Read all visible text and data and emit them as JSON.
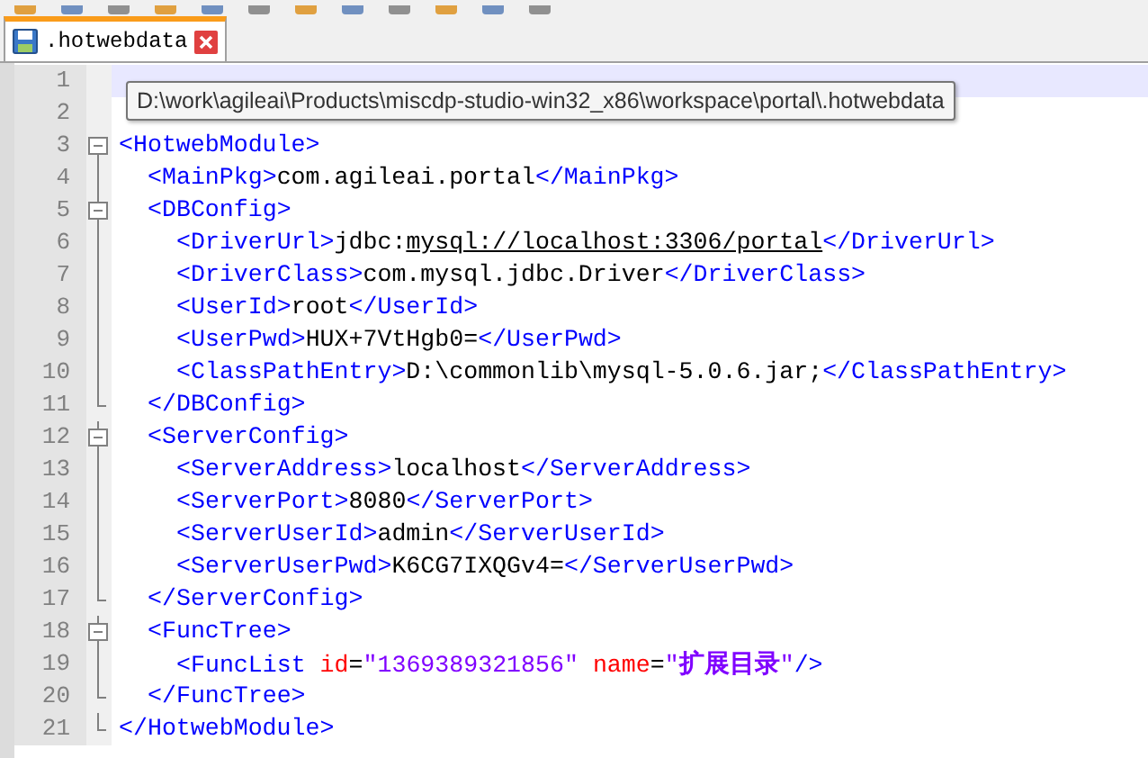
{
  "tab": {
    "label": ".hotwebdata",
    "selected": true
  },
  "tooltip": "D:\\work\\agileai\\Products\\miscdp-studio-win32_x86\\workspace\\portal\\.hotwebdata",
  "lines": [
    {
      "number": "1",
      "current": true
    },
    {
      "number": "2",
      "current": false
    },
    {
      "number": "3",
      "current": false,
      "tokens": [
        {
          "kind": "tag",
          "text": "<HotwebModule>"
        }
      ],
      "children": [
        {
          "number": "4",
          "current": false,
          "tokens": [
            {
              "kind": "tag",
              "text": "<MainPkg>"
            },
            {
              "kind": "text",
              "text": "com.agileai.portal"
            },
            {
              "kind": "tag",
              "text": "</MainPkg>"
            }
          ]
        },
        {
          "number": "5",
          "current": false,
          "tokens": [
            {
              "kind": "tag",
              "text": "<DBConfig>"
            }
          ],
          "children": [
            {
              "number": "6",
              "current": false,
              "tokens": [
                {
                  "kind": "tag",
                  "text": "<DriverUrl>"
                },
                {
                  "kind": "text",
                  "text": "jdbc:"
                },
                {
                  "kind": "link",
                  "text": "mysql://localhost:3306/portal"
                },
                {
                  "kind": "tag",
                  "text": "</DriverUrl>"
                }
              ]
            },
            {
              "number": "7",
              "current": false,
              "tokens": [
                {
                  "kind": "tag",
                  "text": "<DriverClass>"
                },
                {
                  "kind": "text",
                  "text": "com.mysql.jdbc.Driver"
                },
                {
                  "kind": "tag",
                  "text": "</DriverClass>"
                }
              ]
            },
            {
              "number": "8",
              "current": false,
              "tokens": [
                {
                  "kind": "tag",
                  "text": "<UserId>"
                },
                {
                  "kind": "text",
                  "text": "root"
                },
                {
                  "kind": "tag",
                  "text": "</UserId>"
                }
              ]
            },
            {
              "number": "9",
              "current": false,
              "tokens": [
                {
                  "kind": "tag",
                  "text": "<UserPwd>"
                },
                {
                  "kind": "text",
                  "text": "HUX+7VtHgb0="
                },
                {
                  "kind": "tag",
                  "text": "</UserPwd>"
                }
              ]
            },
            {
              "number": "10",
              "current": false,
              "tokens": [
                {
                  "kind": "tag",
                  "text": "<ClassPathEntry>"
                },
                {
                  "kind": "text",
                  "text": "D:\\commonlib\\mysql-5.0.6.jar;"
                },
                {
                  "kind": "tag",
                  "text": "</ClassPathEntry>"
                }
              ]
            }
          ],
          "closing": {
            "number": "11",
            "current": false,
            "tokens": [
              {
                "kind": "tag",
                "text": "</DBConfig>"
              }
            ]
          }
        },
        {
          "number": "12",
          "current": false,
          "tokens": [
            {
              "kind": "tag",
              "text": "<ServerConfig>"
            }
          ],
          "children": [
            {
              "number": "13",
              "current": false,
              "tokens": [
                {
                  "kind": "tag",
                  "text": "<ServerAddress>"
                },
                {
                  "kind": "text",
                  "text": "localhost"
                },
                {
                  "kind": "tag",
                  "text": "</ServerAddress>"
                }
              ]
            },
            {
              "number": "14",
              "current": false,
              "tokens": [
                {
                  "kind": "tag",
                  "text": "<ServerPort>"
                },
                {
                  "kind": "text",
                  "text": "8080"
                },
                {
                  "kind": "tag",
                  "text": "</ServerPort>"
                }
              ]
            },
            {
              "number": "15",
              "current": false,
              "tokens": [
                {
                  "kind": "tag",
                  "text": "<ServerUserId>"
                },
                {
                  "kind": "text",
                  "text": "admin"
                },
                {
                  "kind": "tag",
                  "text": "</ServerUserId>"
                }
              ]
            },
            {
              "number": "16",
              "current": false,
              "tokens": [
                {
                  "kind": "tag",
                  "text": "<ServerUserPwd>"
                },
                {
                  "kind": "text",
                  "text": "K6CG7IXQGv4="
                },
                {
                  "kind": "tag",
                  "text": "</ServerUserPwd>"
                }
              ]
            }
          ],
          "closing": {
            "number": "17",
            "current": false,
            "tokens": [
              {
                "kind": "tag",
                "text": "</ServerConfig>"
              }
            ]
          }
        },
        {
          "number": "18",
          "current": false,
          "tokens": [
            {
              "kind": "tag",
              "text": "<FuncTree>"
            }
          ],
          "children": [
            {
              "number": "19",
              "current": false,
              "tokens": [
                {
                  "kind": "tag",
                  "text": "<FuncList"
                },
                {
                  "kind": "attr",
                  "text": " id"
                },
                {
                  "kind": "text",
                  "text": "="
                },
                {
                  "kind": "value",
                  "text": "\"1369389321856\""
                },
                {
                  "kind": "attr",
                  "text": " name"
                },
                {
                  "kind": "text",
                  "text": "="
                },
                {
                  "kind": "value",
                  "text": "\""
                },
                {
                  "kind": "cjk",
                  "text": "扩展目录"
                },
                {
                  "kind": "value",
                  "text": "\""
                },
                {
                  "kind": "tag",
                  "text": "/>"
                }
              ]
            }
          ],
          "closing": {
            "number": "20",
            "current": false,
            "tokens": [
              {
                "kind": "tag",
                "text": "</FuncTree>"
              }
            ]
          }
        }
      ],
      "closing": {
        "number": "21",
        "current": false,
        "tokens": [
          {
            "kind": "tag",
            "text": "</HotwebModule>"
          }
        ]
      }
    }
  ]
}
